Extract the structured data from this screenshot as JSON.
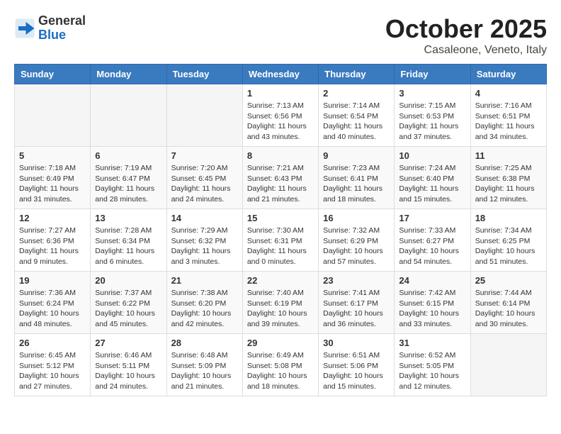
{
  "header": {
    "logo_general": "General",
    "logo_blue": "Blue",
    "month_title": "October 2025",
    "location": "Casaleone, Veneto, Italy"
  },
  "weekdays": [
    "Sunday",
    "Monday",
    "Tuesday",
    "Wednesday",
    "Thursday",
    "Friday",
    "Saturday"
  ],
  "weeks": [
    [
      {
        "day": "",
        "info": ""
      },
      {
        "day": "",
        "info": ""
      },
      {
        "day": "",
        "info": ""
      },
      {
        "day": "1",
        "info": "Sunrise: 7:13 AM\nSunset: 6:56 PM\nDaylight: 11 hours and 43 minutes."
      },
      {
        "day": "2",
        "info": "Sunrise: 7:14 AM\nSunset: 6:54 PM\nDaylight: 11 hours and 40 minutes."
      },
      {
        "day": "3",
        "info": "Sunrise: 7:15 AM\nSunset: 6:53 PM\nDaylight: 11 hours and 37 minutes."
      },
      {
        "day": "4",
        "info": "Sunrise: 7:16 AM\nSunset: 6:51 PM\nDaylight: 11 hours and 34 minutes."
      }
    ],
    [
      {
        "day": "5",
        "info": "Sunrise: 7:18 AM\nSunset: 6:49 PM\nDaylight: 11 hours and 31 minutes."
      },
      {
        "day": "6",
        "info": "Sunrise: 7:19 AM\nSunset: 6:47 PM\nDaylight: 11 hours and 28 minutes."
      },
      {
        "day": "7",
        "info": "Sunrise: 7:20 AM\nSunset: 6:45 PM\nDaylight: 11 hours and 24 minutes."
      },
      {
        "day": "8",
        "info": "Sunrise: 7:21 AM\nSunset: 6:43 PM\nDaylight: 11 hours and 21 minutes."
      },
      {
        "day": "9",
        "info": "Sunrise: 7:23 AM\nSunset: 6:41 PM\nDaylight: 11 hours and 18 minutes."
      },
      {
        "day": "10",
        "info": "Sunrise: 7:24 AM\nSunset: 6:40 PM\nDaylight: 11 hours and 15 minutes."
      },
      {
        "day": "11",
        "info": "Sunrise: 7:25 AM\nSunset: 6:38 PM\nDaylight: 11 hours and 12 minutes."
      }
    ],
    [
      {
        "day": "12",
        "info": "Sunrise: 7:27 AM\nSunset: 6:36 PM\nDaylight: 11 hours and 9 minutes."
      },
      {
        "day": "13",
        "info": "Sunrise: 7:28 AM\nSunset: 6:34 PM\nDaylight: 11 hours and 6 minutes."
      },
      {
        "day": "14",
        "info": "Sunrise: 7:29 AM\nSunset: 6:32 PM\nDaylight: 11 hours and 3 minutes."
      },
      {
        "day": "15",
        "info": "Sunrise: 7:30 AM\nSunset: 6:31 PM\nDaylight: 11 hours and 0 minutes."
      },
      {
        "day": "16",
        "info": "Sunrise: 7:32 AM\nSunset: 6:29 PM\nDaylight: 10 hours and 57 minutes."
      },
      {
        "day": "17",
        "info": "Sunrise: 7:33 AM\nSunset: 6:27 PM\nDaylight: 10 hours and 54 minutes."
      },
      {
        "day": "18",
        "info": "Sunrise: 7:34 AM\nSunset: 6:25 PM\nDaylight: 10 hours and 51 minutes."
      }
    ],
    [
      {
        "day": "19",
        "info": "Sunrise: 7:36 AM\nSunset: 6:24 PM\nDaylight: 10 hours and 48 minutes."
      },
      {
        "day": "20",
        "info": "Sunrise: 7:37 AM\nSunset: 6:22 PM\nDaylight: 10 hours and 45 minutes."
      },
      {
        "day": "21",
        "info": "Sunrise: 7:38 AM\nSunset: 6:20 PM\nDaylight: 10 hours and 42 minutes."
      },
      {
        "day": "22",
        "info": "Sunrise: 7:40 AM\nSunset: 6:19 PM\nDaylight: 10 hours and 39 minutes."
      },
      {
        "day": "23",
        "info": "Sunrise: 7:41 AM\nSunset: 6:17 PM\nDaylight: 10 hours and 36 minutes."
      },
      {
        "day": "24",
        "info": "Sunrise: 7:42 AM\nSunset: 6:15 PM\nDaylight: 10 hours and 33 minutes."
      },
      {
        "day": "25",
        "info": "Sunrise: 7:44 AM\nSunset: 6:14 PM\nDaylight: 10 hours and 30 minutes."
      }
    ],
    [
      {
        "day": "26",
        "info": "Sunrise: 6:45 AM\nSunset: 5:12 PM\nDaylight: 10 hours and 27 minutes."
      },
      {
        "day": "27",
        "info": "Sunrise: 6:46 AM\nSunset: 5:11 PM\nDaylight: 10 hours and 24 minutes."
      },
      {
        "day": "28",
        "info": "Sunrise: 6:48 AM\nSunset: 5:09 PM\nDaylight: 10 hours and 21 minutes."
      },
      {
        "day": "29",
        "info": "Sunrise: 6:49 AM\nSunset: 5:08 PM\nDaylight: 10 hours and 18 minutes."
      },
      {
        "day": "30",
        "info": "Sunrise: 6:51 AM\nSunset: 5:06 PM\nDaylight: 10 hours and 15 minutes."
      },
      {
        "day": "31",
        "info": "Sunrise: 6:52 AM\nSunset: 5:05 PM\nDaylight: 10 hours and 12 minutes."
      },
      {
        "day": "",
        "info": ""
      }
    ]
  ]
}
